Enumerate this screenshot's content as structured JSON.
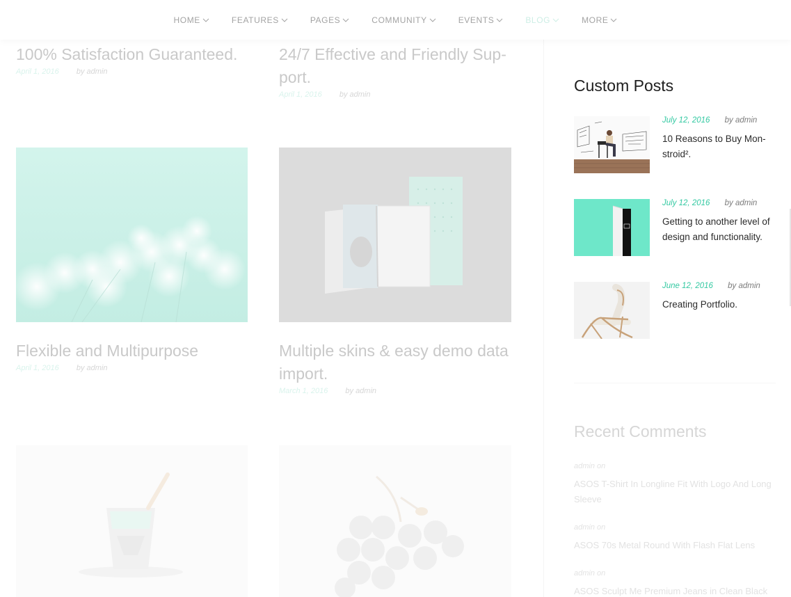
{
  "nav": {
    "items": [
      {
        "label": "HOME"
      },
      {
        "label": "FEATURES"
      },
      {
        "label": "PAGES"
      },
      {
        "label": "COMMUNITY"
      },
      {
        "label": "EVENTS"
      },
      {
        "label": "BLOG",
        "active": true
      },
      {
        "label": "MORE"
      }
    ]
  },
  "posts": [
    {
      "title": "100% Satisfaction Guaranteed.",
      "date": "April 1, 2016",
      "author": "by admin"
    },
    {
      "title": "24/7 Effective and Friendly Sup-port.",
      "title_line1": "24/7 Effective and Friendly Sup-",
      "title_line2": "port.",
      "date": "April 1, 2016",
      "author": "by admin"
    },
    {
      "title": "Flexible and Multipurpose",
      "date": "April 1, 2016",
      "author": "by admin",
      "image": "flowers-photo"
    },
    {
      "title": "Multiple skins & easy demo data import.",
      "title_line1": "Multiple skins & easy demo data",
      "title_line2": "import.",
      "date": "March 1, 2016",
      "author": "by admin",
      "image": "notebook-photo"
    },
    {
      "image": "cup-photo"
    },
    {
      "image": "berries-photo"
    }
  ],
  "sidebar": {
    "custom_posts": {
      "title": "Custom Posts",
      "items": [
        {
          "date": "July 12, 2016",
          "author": "by admin",
          "title": "10 Reasons to Buy Mon-stroid².",
          "title_line1": "10 Reasons to Buy Mon-",
          "title_line2": "stroid².",
          "image": "man-sitting-photo"
        },
        {
          "date": "July 12, 2016",
          "author": "by admin",
          "title": "Getting to another level of design and functionality.",
          "image": "tablet-photo"
        },
        {
          "date": "June 12, 2016",
          "author": "by admin",
          "title": "Creating Portfolio.",
          "image": "chair-photo"
        }
      ]
    },
    "recent_comments": {
      "title": "Recent Comments",
      "items": [
        {
          "meta": "admin  on",
          "link": "ASOS T-Shirt In Longline Fit With Logo And Long Sleeve"
        },
        {
          "meta": "admin  on",
          "link": "ASOS 70s Metal Round With Flash Flat Lens"
        },
        {
          "meta": "admin  on",
          "link": "ASOS Sculpt Me Premium Jeans in Clean Black"
        }
      ]
    }
  },
  "colors": {
    "accent": "#34c9a2",
    "accent_faded": "#d9f3ec",
    "mint_panel": "#6ee7c9"
  }
}
